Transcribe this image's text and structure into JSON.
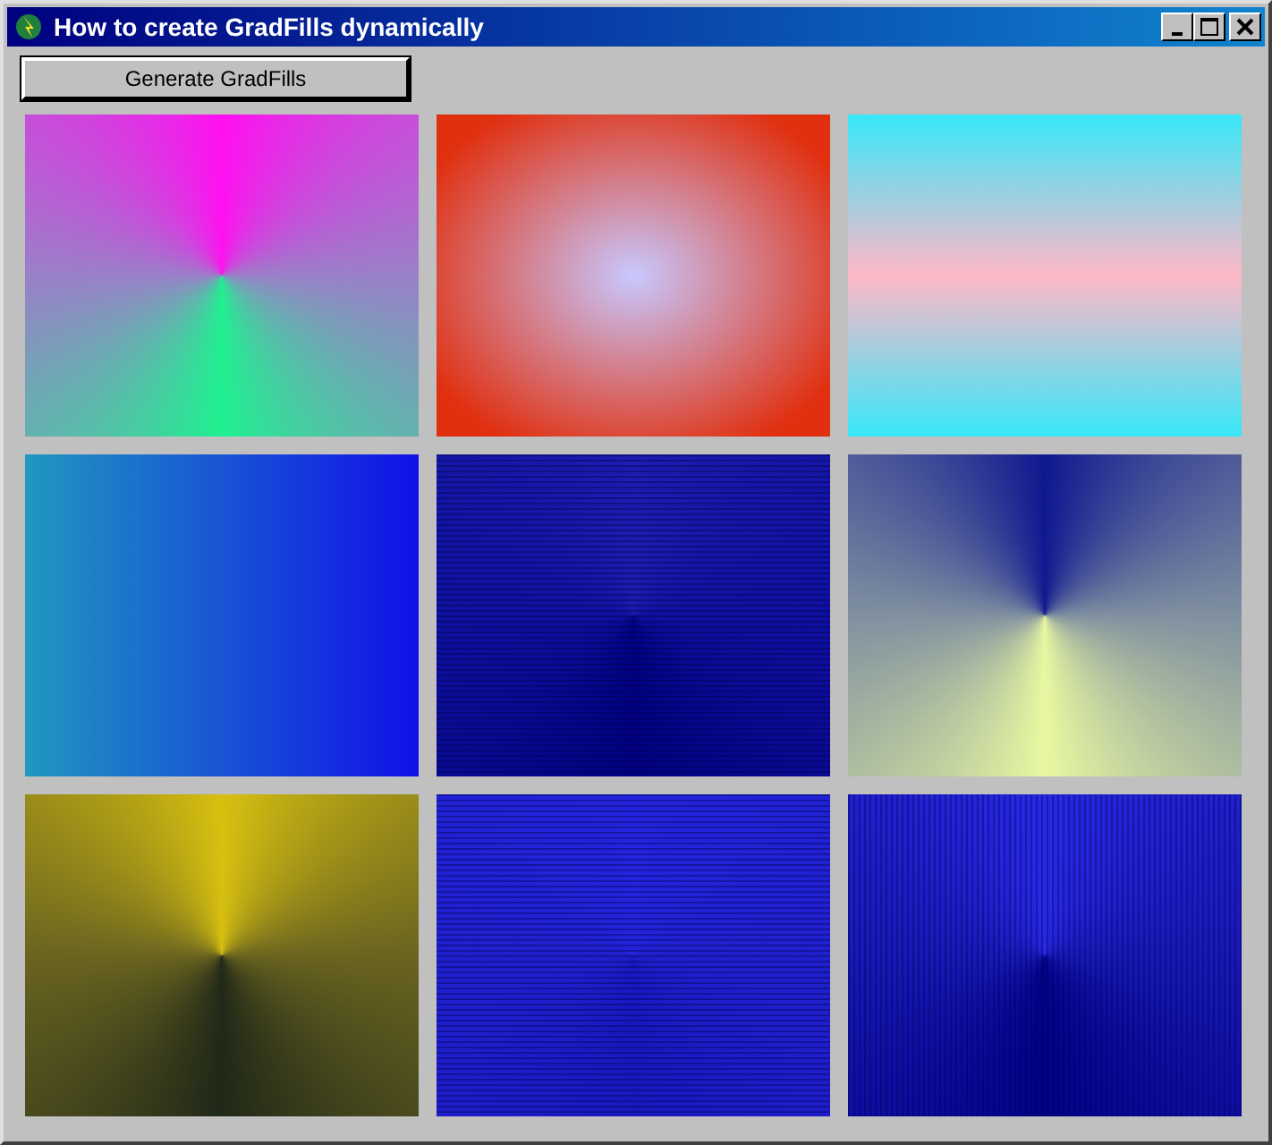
{
  "window": {
    "title": "How to create GradFills dynamically"
  },
  "button": {
    "label": "Generate GradFills"
  },
  "fills": [
    {
      "kind": "burst"
    },
    {
      "kind": "radial"
    },
    {
      "kind": "vertical"
    },
    {
      "kind": "horizontal"
    },
    {
      "kind": "rowburst"
    },
    {
      "kind": "burst"
    },
    {
      "kind": "burst"
    },
    {
      "kind": "rowburst"
    },
    {
      "kind": "columnburst"
    }
  ]
}
